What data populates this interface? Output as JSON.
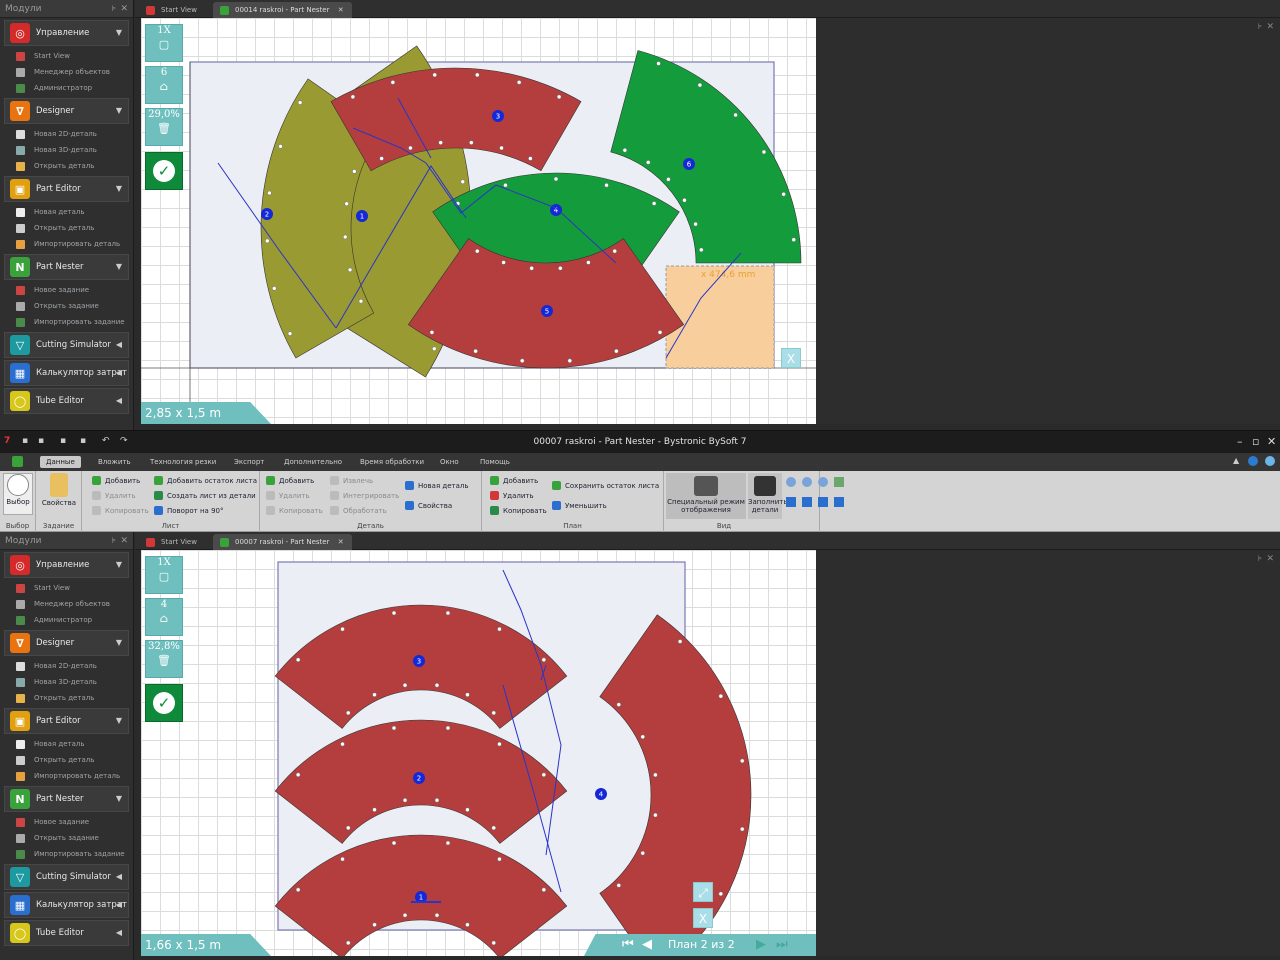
{
  "sidebar": {
    "header": "Модули",
    "groups": [
      {
        "label": "Управление",
        "color": "#d42a2a",
        "glyph": "◎",
        "arrow": "▼",
        "items": [
          "Start View",
          "Менеджер объектов",
          "Администратор"
        ]
      },
      {
        "label": "Designer",
        "color": "#e8730f",
        "glyph": "∇",
        "arrow": "▼",
        "items": [
          "Новая 2D-деталь",
          "Новая 3D-деталь",
          "Открыть деталь"
        ]
      },
      {
        "label": "Part Editor",
        "color": "#e0a010",
        "glyph": "▣",
        "arrow": "▼",
        "items": [
          "Новая деталь",
          "Открыть деталь",
          "Импортировать деталь"
        ]
      },
      {
        "label": "Part Nester",
        "color": "#3aa23a",
        "glyph": "N",
        "arrow": "▼",
        "items": [
          "Новое задание",
          "Открыть задание",
          "Импортировать задание"
        ]
      },
      {
        "label": "Cutting Simulator",
        "color": "#1d9aa0",
        "glyph": "▽",
        "arrow": "◀",
        "items": []
      },
      {
        "label": "Калькулятор затрат",
        "color": "#2a6fd0",
        "glyph": "▦",
        "arrow": "◀",
        "items": []
      },
      {
        "label": "Tube Editor",
        "color": "#d6c71a",
        "glyph": "◯",
        "arrow": "◀",
        "items": []
      }
    ]
  },
  "top": {
    "tabs": {
      "start": "Start View",
      "doc": "00014 raskroi - Part Nester"
    },
    "tools": {
      "zoom": "1X",
      "count": "6",
      "percent": "29,0%"
    },
    "size": "2,85 x 1,5 m",
    "measure": "x 474,6 mm",
    "close_small": "X",
    "parts": [
      {
        "n": "1",
        "color": "#9a9a32"
      },
      {
        "n": "2",
        "color": "#9a9a32"
      },
      {
        "n": "3",
        "color": "#b43e3e"
      },
      {
        "n": "4",
        "color": "#149c3c"
      },
      {
        "n": "5",
        "color": "#b43e3e"
      },
      {
        "n": "6",
        "color": "#149c3c"
      }
    ]
  },
  "app": {
    "title": "00007 raskroi - Part Nester - Bystronic BySoft 7",
    "menu": [
      "Данные",
      "Вложить",
      "Технология резки",
      "Экспорт",
      "Дополнительно",
      "Время обработки",
      "Окно",
      "Помощь"
    ]
  },
  "ribbon": {
    "select": "Выбор",
    "select_group": "Выбор",
    "props": "Свойства",
    "task_group": "Задание",
    "sheet": {
      "add": "Добавить",
      "delete": "Удалить",
      "copy": "Копировать",
      "add_remnant": "Добавить остаток листа",
      "create_from_part": "Создать лист из детали",
      "rotate": "Поворот на 90°",
      "group": "Лист"
    },
    "part": {
      "add": "Добавить",
      "delete": "Удалить",
      "copy": "Копировать",
      "extract": "Извлечь",
      "integrate": "Интегрировать",
      "process": "Обработать",
      "new_part": "Новая деталь",
      "props": "Свойства",
      "group": "Деталь"
    },
    "plan": {
      "add": "Добавить",
      "delete": "Удалить",
      "copy": "Копировать",
      "save_remnant": "Сохранить остаток листа",
      "shrink": "Уменьшить",
      "group": "План"
    },
    "view": {
      "special": "Специальный режим отображения",
      "fill": "Заполнить детали",
      "group": "Вид"
    }
  },
  "bottom": {
    "tabs": {
      "start": "Start View",
      "doc": "00007 raskroi - Part Nester"
    },
    "tools": {
      "zoom": "1X",
      "count": "4",
      "percent": "32,8%"
    },
    "size": "1,66 x 1,5 m",
    "plan_label": "План 2 из 2",
    "close_small": "X",
    "parts": [
      {
        "n": "1",
        "color": "#b43e3e"
      },
      {
        "n": "2",
        "color": "#b43e3e"
      },
      {
        "n": "3",
        "color": "#b43e3e"
      },
      {
        "n": "4",
        "color": "#b43e3e"
      }
    ]
  },
  "colors": {
    "accent": "#6fbfbf",
    "ok": "#0e8a3a",
    "sheet": "#eceef5",
    "remnant": "#f8cf9c"
  }
}
